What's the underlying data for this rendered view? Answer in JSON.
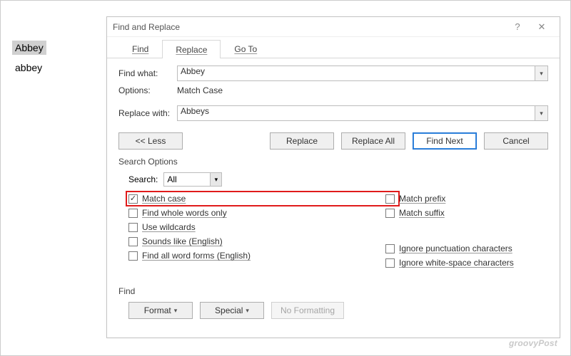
{
  "doc": {
    "word1": "Abbey",
    "word2": "abbey"
  },
  "dialog": {
    "title": "Find and Replace",
    "help": "?",
    "close": "✕",
    "tabs": {
      "find": "Find",
      "replace": "Replace",
      "goto": "Go To"
    },
    "find_what_label": "Find what:",
    "find_what_value": "Abbey",
    "options_label": "Options:",
    "options_value": "Match Case",
    "replace_with_label": "Replace with:",
    "replace_with_value": "Abbeys",
    "buttons": {
      "less": "<< Less",
      "replace": "Replace",
      "replace_all": "Replace All",
      "find_next": "Find Next",
      "cancel": "Cancel"
    },
    "search_options_label": "Search Options",
    "search_label": "Search:",
    "search_value": "All",
    "checks": {
      "match_case": "Match case",
      "whole_words": "Find whole words only",
      "wildcards": "Use wildcards",
      "sounds_like": "Sounds like (English)",
      "word_forms": "Find all word forms (English)",
      "match_prefix": "Match prefix",
      "match_suffix": "Match suffix",
      "ignore_punct": "Ignore punctuation characters",
      "ignore_ws": "Ignore white-space characters"
    },
    "find_section_label": "Find",
    "format_btn": "Format",
    "special_btn": "Special",
    "no_formatting_btn": "No Formatting"
  },
  "watermark": "groovyPost"
}
